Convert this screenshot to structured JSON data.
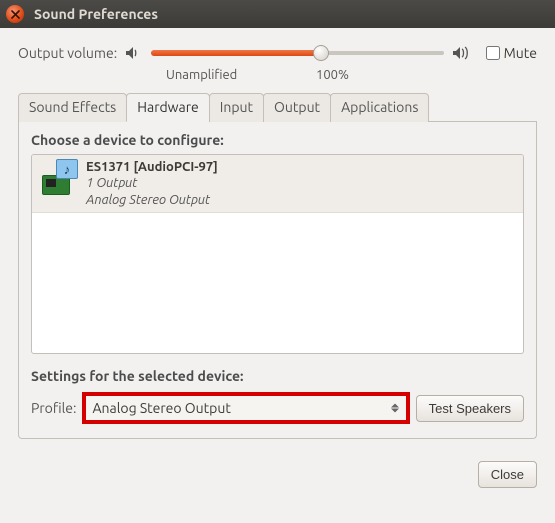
{
  "window": {
    "title": "Sound Preferences"
  },
  "volume": {
    "label": "Output volume:",
    "mute_label": "Mute",
    "muted": false,
    "value_percent": 58,
    "scale": {
      "unamplified": "Unamplified",
      "p100": "100%"
    }
  },
  "tabs": [
    {
      "id": "sound-effects",
      "label": "Sound Effects"
    },
    {
      "id": "hardware",
      "label": "Hardware"
    },
    {
      "id": "input",
      "label": "Input"
    },
    {
      "id": "output",
      "label": "Output"
    },
    {
      "id": "applications",
      "label": "Applications"
    }
  ],
  "active_tab": "hardware",
  "hardware": {
    "choose_label": "Choose a device to configure:",
    "devices": [
      {
        "name": "ES1371 [AudioPCI-97]",
        "outputs": "1 Output",
        "profile": "Analog Stereo Output"
      }
    ],
    "settings_label": "Settings for the selected device:",
    "profile_label": "Profile:",
    "selected_profile": "Analog Stereo Output",
    "test_speakers_label": "Test Speakers"
  },
  "footer": {
    "close_label": "Close"
  }
}
